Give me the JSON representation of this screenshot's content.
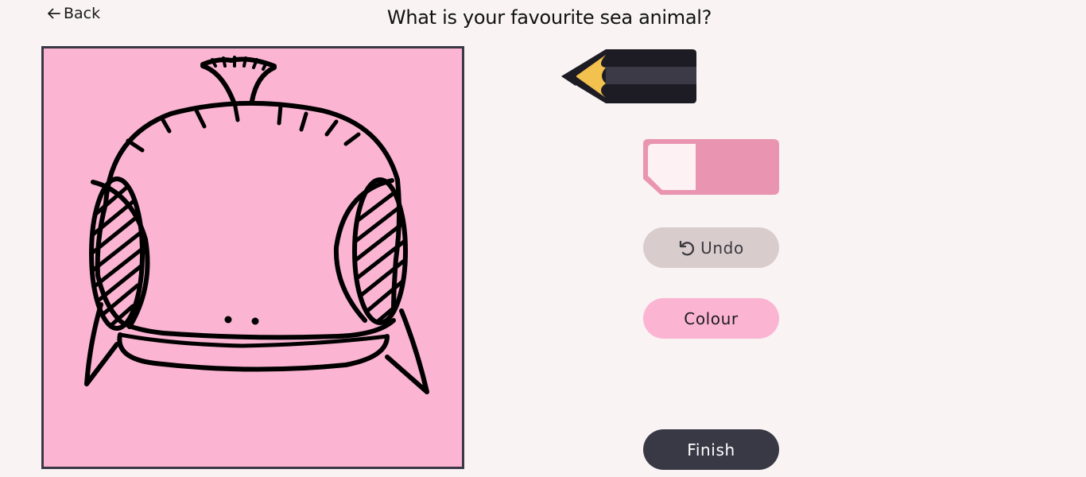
{
  "header": {
    "back_label": "Back",
    "title": "What is your favourite sea animal?"
  },
  "canvas": {
    "background_color": "#fbb5d3",
    "border_color": "#393845",
    "stroke_color": "#000000"
  },
  "tools": {
    "pencil": {
      "icon": "pencil-icon",
      "selected": true
    },
    "eraser": {
      "icon": "eraser-icon",
      "selected": false
    }
  },
  "actions": {
    "undo_label": "Undo",
    "undo_icon": "undo-icon",
    "colour_label": "Colour",
    "finish_label": "Finish"
  },
  "colors": {
    "page_background": "#f9f3f3",
    "undo_button": "#d9cccc",
    "colour_button": "#fbb5d3",
    "finish_button": "#393845"
  }
}
